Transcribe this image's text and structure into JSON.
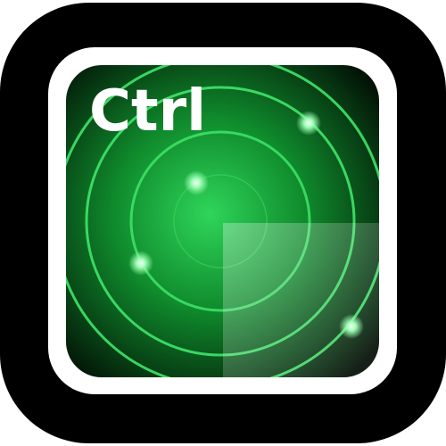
{
  "app": {
    "label": "Ctrl"
  },
  "icon": {
    "name": "radar-icon",
    "colors": {
      "outer_frame": "#000000",
      "inner_border": "#ffffff",
      "screen_center": "#2fd55a",
      "screen_mid": "#0f8a2c",
      "screen_edge": "#020c04",
      "ring_stroke": "#3fe56a",
      "blip": "#9dffb4",
      "sweep": "#ffffff",
      "label": "#ffffff"
    }
  }
}
